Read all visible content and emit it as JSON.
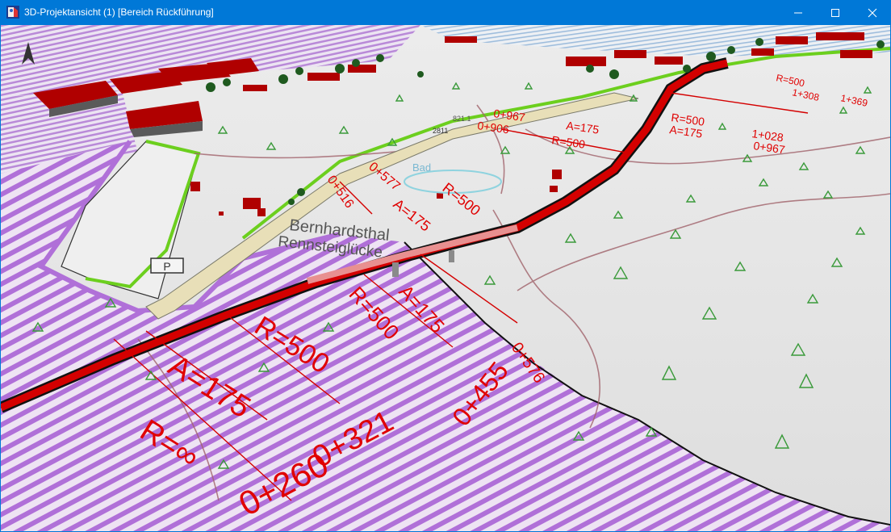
{
  "window": {
    "title": "3D-Projektansicht (1) [Bereich Rückführung]",
    "app_icon": "3d-project-icon",
    "controls": {
      "minimize": "minimize-icon",
      "maximize": "maximize-icon",
      "close": "close-icon"
    }
  },
  "scene": {
    "place_label_1": "Bernhardsthal",
    "place_label_2": "Rennsteiglücke",
    "water_label": "Bad",
    "parking_label": "P",
    "road_sign_label": "2811",
    "height_label": "821.1",
    "station_labels": [
      "0+260",
      "R=∞",
      "A=175",
      "0+321",
      "R=500",
      "0+455",
      "R=500",
      "A=175",
      "0+576",
      "0+516",
      "0+577",
      "R=500",
      "A=175",
      "0+967",
      "0+906",
      "A=175",
      "R=500",
      "R=500",
      "A=175",
      "1+028",
      "0+967",
      "1+369",
      "1+308",
      "R=500"
    ],
    "colors": {
      "road": "#d40000",
      "alignment_text": "#e00000",
      "protection_zone": "#b070d8",
      "boundary_green": "#6ccf1e",
      "terrain": "#e6e6e6",
      "buildings": "#b00000",
      "symbol": "#3a9a3a",
      "contour": "#a0626a"
    }
  }
}
